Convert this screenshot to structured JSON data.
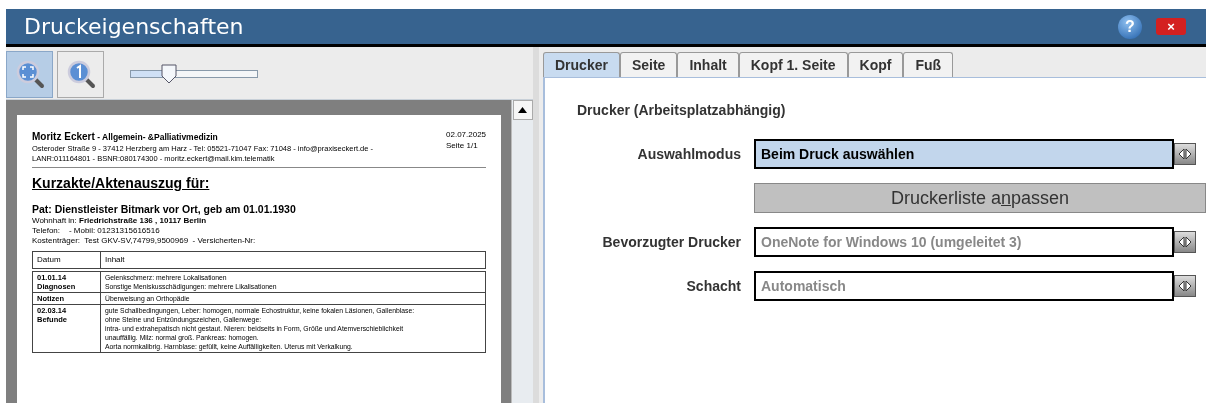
{
  "window": {
    "title": "Druckeigenschaften",
    "buttons": [
      {
        "kind": "help",
        "label": "?"
      },
      {
        "kind": "close",
        "label": "×"
      }
    ]
  },
  "toolbar": {
    "zoom_buttons": [
      {
        "kind": "fit",
        "selected": true
      },
      {
        "kind": "actual",
        "selected": false
      }
    ],
    "zoom_slider": {
      "level": 0.3
    }
  },
  "preview": {
    "header": {
      "name": "Moritz Eckert",
      "specialty": " - Allgemein- &Palliativmedizin",
      "lines": [
        "Osteroder Straße 9 - 37412 Herzberg am Harz - Tel: 05521-71047 Fax: 71048 - info@praxiseckert.de -",
        "LANR:011164801 - BSNR:080174300 - moritz.eckert@mail.kim.telematik"
      ],
      "date": "02.07.2025",
      "page": "Seite 1/1"
    },
    "title": "Kurzakte/Aktenauszug für:",
    "patient": "Pat: Dienstleister Bitmark vor Ort, geb am 01.01.1930",
    "details": [
      "Wohnhaft in: **Friedrichstraße 136 , 10117 Berlin**",
      "Telefon:    - Mobil: 01231315616516",
      "Kostenträger:  Test GKV-SV,74799,9500969  - Versicherten-Nr:"
    ],
    "table": {
      "columns": [
        "Datum",
        "Inhalt"
      ],
      "rows": [
        {
          "label": [
            "01.01.14",
            "Diagnosen"
          ],
          "lines": [
            "Gelenkschmerz: mehrere Lokalisationen",
            "Sonstige Meniskusschädigungen: mehrere Likalisationen"
          ]
        },
        {
          "label": [
            "Notizen"
          ],
          "lines": [
            "Überweisung an Orthopädie"
          ]
        },
        {
          "label": [
            "02.03.14",
            "Befunde"
          ],
          "lines": [
            "gute Schallbedingungen, Leber: homogen, normale Echostruktur, keine fokalen Läsionen, Gallenblase:",
            "ohne Steine und Entzündungszeichen, Gallenwege:",
            "intra- und extrahepatisch nicht gestaut. Nieren: beidseits in Form, Größe und Atemverschieblichkeit",
            "unauffällig. Milz: normal groß. Pankreas: homogen.",
            "Aorta normkalibrig. Harnblase: gefüllt, keine Auffälligkeiten. Uterus mit Verkalkung."
          ]
        }
      ]
    }
  },
  "tabs": [
    {
      "label": "Drucker",
      "selected": true
    },
    {
      "label": "Seite",
      "selected": false
    },
    {
      "label": "Inhalt",
      "selected": false
    },
    {
      "label": "Kopf 1. Seite",
      "selected": false
    },
    {
      "label": "Kopf",
      "selected": false
    },
    {
      "label": "Fuß",
      "selected": false
    }
  ],
  "section_title": "Drucker (Arbeitsplatzabhängig)",
  "form": [
    {
      "kind": "select",
      "label": "Auswahlmodus",
      "value": "Beim Druck auswählen",
      "highlighted": true
    },
    {
      "kind": "button",
      "label": "Druckerliste a",
      "mnemonic": "n",
      "label_rest": "passen"
    },
    {
      "kind": "select",
      "label": "Bevorzugter Drucker",
      "value": "OneNote for Windows 10 (umgeleitet 3)",
      "highlighted": false
    },
    {
      "kind": "select",
      "label": "Schacht",
      "value": "Automatisch",
      "highlighted": false
    }
  ]
}
